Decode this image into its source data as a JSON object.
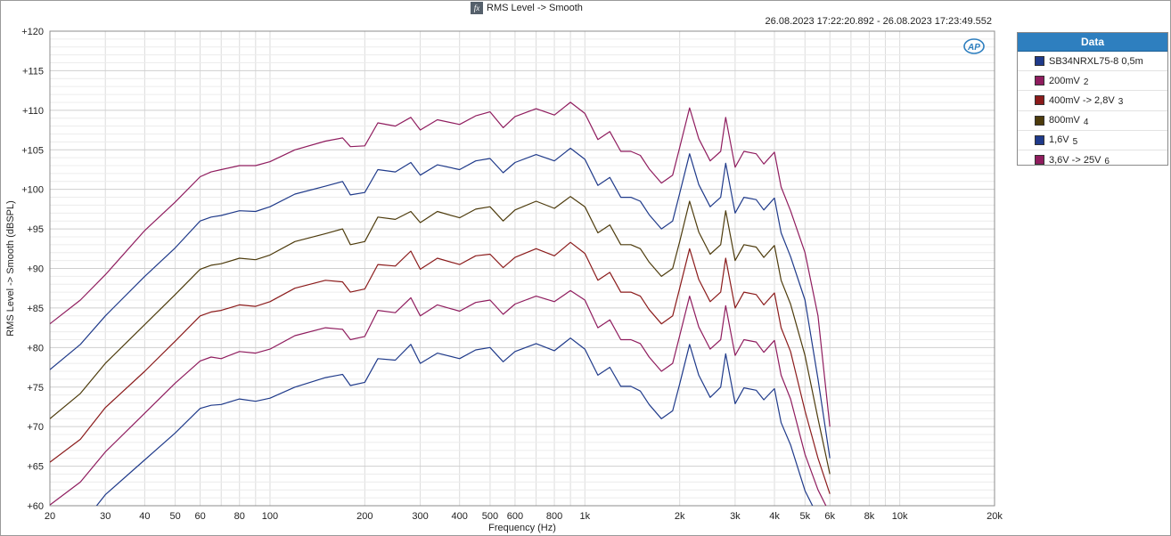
{
  "header": {
    "title": "RMS Level -> Smooth",
    "fx_icon": "fx-function-icon",
    "timestamp": "26.08.2023 17:22:20.892 - 26.08.2023 17:23:49.552",
    "logo": "ap-logo-icon"
  },
  "legend": {
    "title": "Data",
    "items": [
      {
        "label": "SB34NRXL75-8 0,5m",
        "suffix": "",
        "color": "#1f3a8a"
      },
      {
        "label": "200mV",
        "suffix": "2",
        "color": "#8f1c5e"
      },
      {
        "label": "400mV -> 2,8V",
        "suffix": "3",
        "color": "#8b1b1b"
      },
      {
        "label": "800mV",
        "suffix": "4",
        "color": "#4d3b0c"
      },
      {
        "label": "1,6V",
        "suffix": "5",
        "color": "#1f3a8a"
      },
      {
        "label": "3,6V -> 25V",
        "suffix": "6",
        "color": "#8f1c5e"
      }
    ]
  },
  "chart_data": {
    "type": "line",
    "xlabel": "Frequency (Hz)",
    "ylabel": "RMS Level -> Smooth (dBSPL)",
    "xscale": "log",
    "xlim": [
      20,
      20000
    ],
    "ylim": [
      60,
      120
    ],
    "grid": true,
    "legend_position": "right",
    "x_ticks": [
      "20",
      "30",
      "40",
      "50",
      "60",
      "80",
      "100",
      "200",
      "300",
      "400",
      "500",
      "600",
      "800",
      "1k",
      "2k",
      "3k",
      "4k",
      "5k",
      "6k",
      "8k",
      "10k",
      "20k"
    ],
    "y_ticks": [
      "+60",
      "+65",
      "+70",
      "+75",
      "+80",
      "+85",
      "+90",
      "+95",
      "+100",
      "+105",
      "+110",
      "+115",
      "+120"
    ],
    "x": [
      20,
      25,
      30,
      40,
      50,
      60,
      65,
      70,
      80,
      90,
      100,
      120,
      150,
      170,
      180,
      200,
      220,
      250,
      280,
      300,
      340,
      400,
      450,
      500,
      550,
      600,
      700,
      800,
      900,
      1000,
      1100,
      1200,
      1300,
      1400,
      1500,
      1600,
      1750,
      1900,
      2000,
      2150,
      2300,
      2500,
      2700,
      2800,
      3000,
      3200,
      3500,
      3700,
      4000,
      4200,
      4500,
      5000,
      5500,
      6000
    ],
    "series": [
      {
        "name": "SB34NRXL75-8 0,5m",
        "color": "#1f3a8a",
        "values": [
          54.5,
          57.4,
          61.4,
          65.8,
          69.2,
          72.3,
          72.7,
          72.8,
          73.5,
          73.2,
          73.6,
          75.0,
          76.2,
          76.6,
          75.2,
          75.6,
          78.6,
          78.4,
          80.4,
          78.0,
          79.3,
          78.6,
          79.7,
          80.0,
          78.2,
          79.5,
          80.5,
          79.6,
          81.2,
          79.8,
          76.5,
          77.5,
          75.1,
          75.1,
          74.5,
          72.8,
          71.0,
          72.0,
          75.4,
          80.4,
          76.5,
          73.7,
          75.0,
          79.2,
          72.9,
          74.9,
          74.6,
          73.4,
          74.8,
          70.5,
          67.7,
          61.9,
          58.6,
          57.0
        ]
      },
      {
        "name": "200mV",
        "color": "#8f1c5e",
        "values": [
          60.1,
          63.0,
          66.8,
          71.7,
          75.5,
          78.3,
          78.8,
          78.6,
          79.5,
          79.3,
          79.8,
          81.5,
          82.5,
          82.3,
          81.0,
          81.4,
          84.7,
          84.4,
          86.3,
          84.0,
          85.4,
          84.6,
          85.7,
          86.0,
          84.2,
          85.5,
          86.5,
          85.8,
          87.2,
          86.0,
          82.5,
          83.5,
          81.0,
          81.0,
          80.5,
          78.8,
          77.0,
          78.0,
          81.5,
          86.5,
          82.6,
          79.8,
          81.0,
          85.3,
          79.0,
          81.0,
          80.7,
          79.4,
          80.9,
          76.5,
          73.5,
          66.5,
          62.0,
          59.0
        ]
      },
      {
        "name": "400mV -> 2,8V",
        "color": "#8b1b1b",
        "values": [
          65.5,
          68.4,
          72.4,
          77.0,
          80.8,
          84.0,
          84.5,
          84.7,
          85.4,
          85.2,
          85.8,
          87.5,
          88.5,
          88.3,
          87.0,
          87.4,
          90.5,
          90.3,
          92.2,
          89.9,
          91.3,
          90.5,
          91.6,
          91.8,
          90.1,
          91.4,
          92.5,
          91.6,
          93.3,
          91.9,
          88.5,
          89.5,
          87.0,
          87.0,
          86.5,
          84.8,
          83.0,
          84.0,
          87.5,
          92.5,
          88.6,
          85.8,
          87.0,
          91.3,
          85.0,
          87.0,
          86.7,
          85.4,
          86.9,
          82.5,
          79.5,
          72.0,
          66.0,
          61.5
        ]
      },
      {
        "name": "800mV",
        "color": "#4d3b0c",
        "values": [
          71.0,
          74.2,
          78.0,
          82.9,
          86.7,
          89.9,
          90.4,
          90.6,
          91.3,
          91.1,
          91.7,
          93.4,
          94.4,
          95.0,
          93.0,
          93.4,
          96.5,
          96.2,
          97.2,
          95.8,
          97.2,
          96.4,
          97.5,
          97.8,
          96.0,
          97.4,
          98.5,
          97.6,
          99.1,
          97.8,
          94.5,
          95.5,
          93.0,
          93.0,
          92.5,
          90.8,
          89.0,
          90.0,
          93.4,
          98.5,
          94.6,
          91.8,
          93.0,
          97.3,
          91.0,
          93.0,
          92.7,
          91.4,
          92.9,
          88.5,
          85.5,
          79.0,
          71.0,
          64.0
        ]
      },
      {
        "name": "1,6V",
        "color": "#1f3a8a",
        "values": [
          77.2,
          80.4,
          84.0,
          89.0,
          92.6,
          96.0,
          96.5,
          96.7,
          97.3,
          97.2,
          97.8,
          99.4,
          100.4,
          101.0,
          99.3,
          99.6,
          102.5,
          102.2,
          103.4,
          101.8,
          103.1,
          102.5,
          103.6,
          103.9,
          102.1,
          103.4,
          104.4,
          103.6,
          105.2,
          103.8,
          100.5,
          101.5,
          99.0,
          99.0,
          98.5,
          96.8,
          95.0,
          96.0,
          99.5,
          104.5,
          100.6,
          97.8,
          99.0,
          103.3,
          97.0,
          99.0,
          98.7,
          97.4,
          98.9,
          94.5,
          91.5,
          86.0,
          76.0,
          66.0
        ]
      },
      {
        "name": "3,6V -> 25V",
        "color": "#8f1c5e",
        "values": [
          83.0,
          86.0,
          89.2,
          94.8,
          98.4,
          101.6,
          102.2,
          102.5,
          103.0,
          103.0,
          103.5,
          105.0,
          106.1,
          106.5,
          105.4,
          105.5,
          108.4,
          108.0,
          109.1,
          107.5,
          108.8,
          108.2,
          109.3,
          109.8,
          107.8,
          109.2,
          110.2,
          109.4,
          111.0,
          109.6,
          106.3,
          107.3,
          104.8,
          104.8,
          104.3,
          102.6,
          100.8,
          101.8,
          105.3,
          110.3,
          106.4,
          103.6,
          104.8,
          109.1,
          102.8,
          104.8,
          104.5,
          103.2,
          104.7,
          100.3,
          97.3,
          92.0,
          84.0,
          70.0
        ]
      }
    ]
  }
}
